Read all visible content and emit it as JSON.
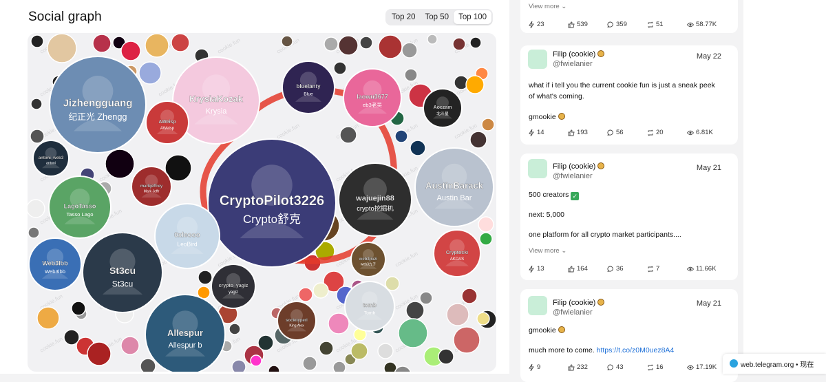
{
  "header": {
    "title": "Social graph",
    "tabs": [
      {
        "label": "Top 20",
        "active": false
      },
      {
        "label": "Top 50",
        "active": false
      },
      {
        "label": "Top 100",
        "active": true
      }
    ]
  },
  "graph": {
    "watermark": "cookie.fun",
    "nodes": [
      {
        "label": "CryptoPilot3226",
        "sub": "Crypto舒克",
        "color": "#3b3c77"
      },
      {
        "label": "Jizhengguang",
        "sub": "纪正光 Zhengg",
        "color": "#6d8db3"
      },
      {
        "label": "KrysiaKozak",
        "sub": "Krysia",
        "color": "#f4c9de"
      },
      {
        "label": "bluelanty",
        "sub": "Blue",
        "color": "#2f2452"
      },
      {
        "label": "laowu3677",
        "sub": "eb3老吴",
        "color": "#e9679a"
      },
      {
        "label": "AustinBarack",
        "sub": "Austin Bar",
        "color": "#b9c2cf"
      },
      {
        "label": "wajuejin88",
        "sub": "crypto挖掘机",
        "color": "#2e2e2e"
      },
      {
        "label": "LagoTasso",
        "sub": "Tasso Lago",
        "color": "#5aa465"
      },
      {
        "label": "0xleooo",
        "sub": "LeoBird",
        "color": "#c8d9e8"
      },
      {
        "label": "St3cu",
        "sub": "St3cu",
        "color": "#2b3a4a"
      },
      {
        "label": "Web3lbb",
        "sub": "Web3lbb",
        "color": "#3a6fb5"
      },
      {
        "label": "Allespur",
        "sub": "Allespur b",
        "color": "#2d5a7a"
      },
      {
        "label": "crypto_yagiz",
        "sub": "yagiz",
        "color": "#2f2f36"
      },
      {
        "label": "tomb",
        "sub": "Tomb",
        "color": "#d8dde2"
      },
      {
        "label": "societyperl",
        "sub": "King Alex",
        "color": "#6d3d2a"
      },
      {
        "label": "Cryptocki",
        "sub": "AKDAS",
        "color": "#d24545"
      },
      {
        "label": "Aoczam",
        "sub": "北斗星",
        "color": "#232323"
      },
      {
        "label": "antoni_web3",
        "sub": "antoni",
        "color": "#1f2e3d"
      },
      {
        "label": "markjeffrey",
        "sub": "Mark Jeffr",
        "color": "#9e2d2d"
      },
      {
        "label": "AWeisp",
        "sub": "AWeisp",
        "color": "#c93a3a"
      },
      {
        "label": "web3jiuzi",
        "sub": "web3九子",
        "color": "#6d5130"
      }
    ]
  },
  "feed": {
    "cards": [
      {
        "view_more": "View more",
        "stats": {
          "fire": "23",
          "likes": "539",
          "replies": "359",
          "retweets": "51",
          "views": "58.77K"
        }
      },
      {
        "name": "Filip (cookie)",
        "handle": "@fwielanier",
        "date": "May 22",
        "lines": [
          "what if i tell you the current cookie fun is just a sneak peek",
          "of what's coming.",
          "",
          "gmookie"
        ],
        "stats": {
          "fire": "14",
          "likes": "193",
          "replies": "56",
          "retweets": "20",
          "views": "6.81K"
        }
      },
      {
        "name": "Filip (cookie)",
        "handle": "@fwielanier",
        "date": "May 21",
        "lines": [
          "500 creators",
          "",
          "next: 5,000",
          "",
          "one platform for all crypto market participants...."
        ],
        "view_more": "View more",
        "stats": {
          "fire": "13",
          "likes": "164",
          "replies": "36",
          "retweets": "7",
          "views": "11.66K"
        }
      },
      {
        "name": "Filip (cookie)",
        "handle": "@fwielanier",
        "date": "May 21",
        "lines": [
          "gmookie",
          "",
          "much more to come."
        ],
        "link": "https://t.co/z0M0uez8A4",
        "stats": {
          "fire": "9",
          "likes": "232",
          "replies": "43",
          "retweets": "16",
          "views": "17.19K"
        }
      }
    ]
  },
  "toast": {
    "site": "web.telegram.org",
    "separator": "•",
    "time": "现在"
  },
  "colors": {
    "accent_red": "#e43a2a",
    "link": "#1c6fd8",
    "avatar_bg": "#c9eed8"
  }
}
